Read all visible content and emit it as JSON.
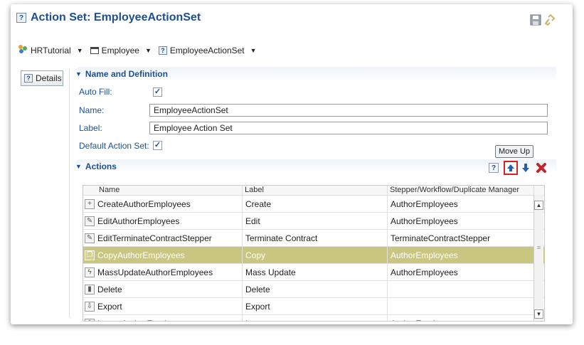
{
  "header": {
    "title": "Action Set: EmployeeActionSet",
    "save_icon": "save-icon",
    "link_icon": "link-icon"
  },
  "breadcrumb": {
    "items": [
      {
        "label": "HRTutorial",
        "icon": "package-icon"
      },
      {
        "label": "Employee",
        "icon": "window-icon"
      },
      {
        "label": "EmployeeActionSet",
        "icon": "help-icon"
      }
    ]
  },
  "tabs": {
    "details": "Details"
  },
  "name_section": {
    "title": "Name and Definition",
    "auto_fill_label": "Auto Fill:",
    "auto_fill_checked": true,
    "name_label": "Name:",
    "name_value": "EmployeeActionSet",
    "label_label": "Label:",
    "label_value": "Employee Action Set",
    "default_label": "Default Action Set:",
    "default_checked": true
  },
  "actions_section": {
    "title": "Actions",
    "tooltip": "Move Up",
    "columns": [
      "Name",
      "Label",
      "Stepper/Workflow/Duplicate Manager"
    ],
    "rows": [
      {
        "icon": "plus-icon",
        "name": "CreateAuthorEmployees",
        "label": "Create",
        "manager": "AuthorEmployees",
        "selected": false
      },
      {
        "icon": "pencil-icon",
        "name": "EditAuthorEmployees",
        "label": "Edit",
        "manager": "AuthorEmployees",
        "selected": false
      },
      {
        "icon": "pencil-icon",
        "name": "EditTerminateContractStepper",
        "label": "Terminate Contract",
        "manager": "TerminateContractStepper",
        "selected": false
      },
      {
        "icon": "copy-icon",
        "name": "CopyAuthorEmployees",
        "label": "Copy",
        "manager": "AuthorEmployees",
        "selected": true
      },
      {
        "icon": "lightning-icon",
        "name": "MassUpdateAuthorEmployees",
        "label": "Mass Update",
        "manager": "AuthorEmployees",
        "selected": false
      },
      {
        "icon": "trash-icon",
        "name": "Delete",
        "label": "Delete",
        "manager": "",
        "selected": false
      },
      {
        "icon": "export-icon",
        "name": "Export",
        "label": "Export",
        "manager": "",
        "selected": false
      },
      {
        "icon": "import-icon",
        "name": "ImportAuthorEmployees",
        "label": "Import",
        "manager": "AuthorEmployees",
        "selected": false
      }
    ]
  },
  "colors": {
    "title": "#1d4f91",
    "selected_row": "#c9c680",
    "delete": "#c0262d",
    "move_up_border": "#d42222"
  }
}
